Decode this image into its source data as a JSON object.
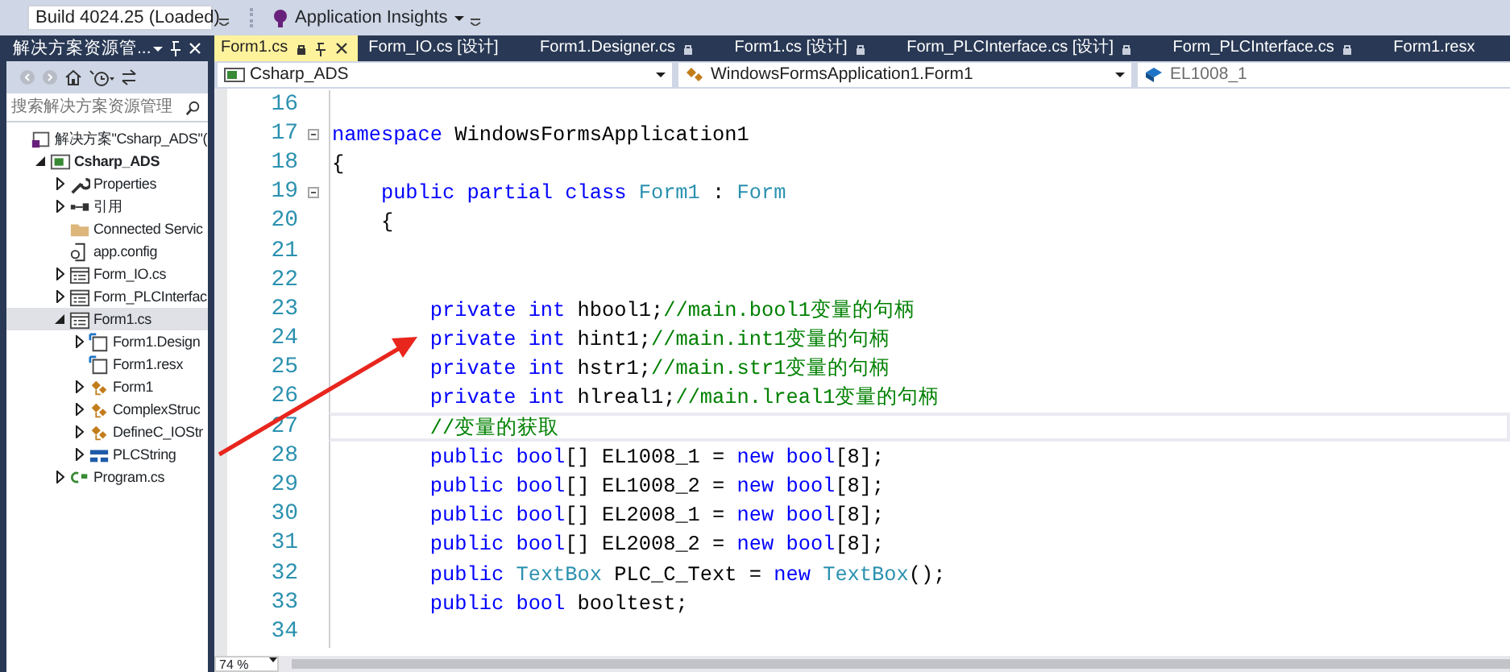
{
  "toolbar": {
    "build_select": "Build 4024.25 (Loaded)",
    "insights_label": "Application Insights"
  },
  "solution_explorer": {
    "title": "解决方案资源管...",
    "search": {
      "placeholder": "搜索解决方案资源管理"
    },
    "tree": [
      {
        "label": "解决方案\"Csharp_ADS\"(",
        "kind": "solution",
        "bold": false,
        "selected": false,
        "children": [
          {
            "label": "Csharp_ADS",
            "kind": "project",
            "expanded": true,
            "bold": true,
            "selected": false,
            "children": [
              {
                "label": "Properties",
                "kind": "properties",
                "expanded": false,
                "bold": false,
                "selected": false
              },
              {
                "label": "引用",
                "kind": "references",
                "expanded": false,
                "bold": false,
                "selected": false
              },
              {
                "label": "Connected Servic",
                "kind": "folder",
                "bold": false,
                "selected": false
              },
              {
                "label": "app.config",
                "kind": "config",
                "bold": false,
                "selected": false
              },
              {
                "label": "Form_IO.cs",
                "kind": "form",
                "expanded": false,
                "bold": false,
                "selected": false
              },
              {
                "label": "Form_PLCInterfac",
                "kind": "form",
                "expanded": false,
                "bold": false,
                "selected": false
              },
              {
                "label": "Form1.cs",
                "kind": "form",
                "expanded": true,
                "bold": false,
                "selected": true,
                "children": [
                  {
                    "label": "Form1.Design",
                    "kind": "designer",
                    "expanded": false,
                    "bold": false,
                    "selected": false
                  },
                  {
                    "label": "Form1.resx",
                    "kind": "designer",
                    "bold": false,
                    "selected": false
                  },
                  {
                    "label": "Form1",
                    "kind": "class",
                    "expanded": false,
                    "bold": false,
                    "selected": false
                  },
                  {
                    "label": "ComplexStruc",
                    "kind": "class",
                    "expanded": false,
                    "bold": false,
                    "selected": false
                  },
                  {
                    "label": "DefineC_IOStr",
                    "kind": "class",
                    "expanded": false,
                    "bold": false,
                    "selected": false
                  },
                  {
                    "label": "PLCString",
                    "kind": "struct",
                    "expanded": false,
                    "bold": false,
                    "selected": false
                  }
                ]
              },
              {
                "label": "Program.cs",
                "kind": "csfile",
                "expanded": false,
                "bold": false,
                "selected": false
              }
            ]
          }
        ]
      }
    ]
  },
  "tabs": [
    {
      "label": "Form1.cs",
      "selected": true,
      "locked": true
    },
    {
      "label": "Form_IO.cs [设计]",
      "selected": false,
      "locked": false
    },
    {
      "label": "Form1.Designer.cs",
      "selected": false,
      "locked": true
    },
    {
      "label": "Form1.cs [设计]",
      "selected": false,
      "locked": true
    },
    {
      "label": "Form_PLCInterface.cs [设计]",
      "selected": false,
      "locked": true
    },
    {
      "label": "Form_PLCInterface.cs",
      "selected": false,
      "locked": true
    },
    {
      "label": "Form1.resx",
      "selected": false,
      "locked": false
    }
  ],
  "navigation": [
    {
      "label": "Csharp_ADS",
      "kind": "project"
    },
    {
      "label": "WindowsFormsApplication1.Form1",
      "kind": "class"
    },
    {
      "label": "EL1008_1",
      "kind": "member"
    }
  ],
  "editor": {
    "zoom": "74 %",
    "lines": [
      {
        "number": "16",
        "foldable": false,
        "current": false
      },
      {
        "number": "17",
        "foldable": true,
        "current": false,
        "tokens": [
          {
            "text": "namespace",
            "kind": "keyword"
          },
          {
            "text": " WindowsFormsApplication1",
            "kind": "plain"
          }
        ]
      },
      {
        "number": "18",
        "foldable": false,
        "current": false,
        "tokens": [
          {
            "text": "{",
            "kind": "plain"
          }
        ]
      },
      {
        "number": "19",
        "foldable": true,
        "current": false,
        "tokens": [
          {
            "text": "    public partial class ",
            "kind": "keyword"
          },
          {
            "text": "Form1",
            "kind": "type"
          },
          {
            "text": " : ",
            "kind": "plain"
          },
          {
            "text": "Form",
            "kind": "type"
          }
        ]
      },
      {
        "number": "20",
        "foldable": false,
        "current": false,
        "tokens": [
          {
            "text": "    {",
            "kind": "plain"
          }
        ]
      },
      {
        "number": "21",
        "foldable": false,
        "current": false
      },
      {
        "number": "22",
        "foldable": false,
        "current": false
      },
      {
        "number": "23",
        "foldable": false,
        "current": false,
        "tokens": [
          {
            "text": "        private int",
            "kind": "keyword"
          },
          {
            "text": " hbool1;",
            "kind": "plain"
          },
          {
            "text": "//main.bool1变量的句柄",
            "kind": "comment"
          }
        ]
      },
      {
        "number": "24",
        "foldable": false,
        "current": false,
        "tokens": [
          {
            "text": "        private int",
            "kind": "keyword"
          },
          {
            "text": " hint1;",
            "kind": "plain"
          },
          {
            "text": "//main.int1变量的句柄",
            "kind": "comment"
          }
        ]
      },
      {
        "number": "25",
        "foldable": false,
        "current": false,
        "tokens": [
          {
            "text": "        private int",
            "kind": "keyword"
          },
          {
            "text": " hstr1;",
            "kind": "plain"
          },
          {
            "text": "//main.str1变量的句柄",
            "kind": "comment"
          }
        ]
      },
      {
        "number": "26",
        "foldable": false,
        "current": false,
        "tokens": [
          {
            "text": "        private int",
            "kind": "keyword"
          },
          {
            "text": " hlreal1;",
            "kind": "plain"
          },
          {
            "text": "//main.lreal1变量的句柄",
            "kind": "comment"
          }
        ]
      },
      {
        "number": "27",
        "foldable": false,
        "current": true,
        "tokens": [
          {
            "text": "        //变量的获取",
            "kind": "comment"
          }
        ]
      },
      {
        "number": "28",
        "foldable": false,
        "current": false,
        "tokens": [
          {
            "text": "        public bool",
            "kind": "keyword"
          },
          {
            "text": "[] EL1008_1 = ",
            "kind": "plain"
          },
          {
            "text": "new bool",
            "kind": "keyword"
          },
          {
            "text": "[8];",
            "kind": "plain"
          }
        ]
      },
      {
        "number": "29",
        "foldable": false,
        "current": false,
        "tokens": [
          {
            "text": "        public bool",
            "kind": "keyword"
          },
          {
            "text": "[] EL1008_2 = ",
            "kind": "plain"
          },
          {
            "text": "new bool",
            "kind": "keyword"
          },
          {
            "text": "[8];",
            "kind": "plain"
          }
        ]
      },
      {
        "number": "30",
        "foldable": false,
        "current": false,
        "tokens": [
          {
            "text": "        public bool",
            "kind": "keyword"
          },
          {
            "text": "[] EL2008_1 = ",
            "kind": "plain"
          },
          {
            "text": "new bool",
            "kind": "keyword"
          },
          {
            "text": "[8];",
            "kind": "plain"
          }
        ]
      },
      {
        "number": "31",
        "foldable": false,
        "current": false,
        "tokens": [
          {
            "text": "        public bool",
            "kind": "keyword"
          },
          {
            "text": "[] EL2008_2 = ",
            "kind": "plain"
          },
          {
            "text": "new bool",
            "kind": "keyword"
          },
          {
            "text": "[8];",
            "kind": "plain"
          }
        ]
      },
      {
        "number": "32",
        "foldable": false,
        "current": false,
        "tokens": [
          {
            "text": "        public ",
            "kind": "keyword"
          },
          {
            "text": "TextBox",
            "kind": "type"
          },
          {
            "text": " PLC_C_Text = ",
            "kind": "plain"
          },
          {
            "text": "new ",
            "kind": "keyword"
          },
          {
            "text": "TextBox",
            "kind": "type"
          },
          {
            "text": "();",
            "kind": "plain"
          }
        ]
      },
      {
        "number": "33",
        "foldable": false,
        "current": false,
        "tokens": [
          {
            "text": "        public bool",
            "kind": "keyword"
          },
          {
            "text": " booltest;",
            "kind": "plain"
          }
        ]
      },
      {
        "number": "34",
        "foldable": false,
        "current": false
      }
    ]
  }
}
